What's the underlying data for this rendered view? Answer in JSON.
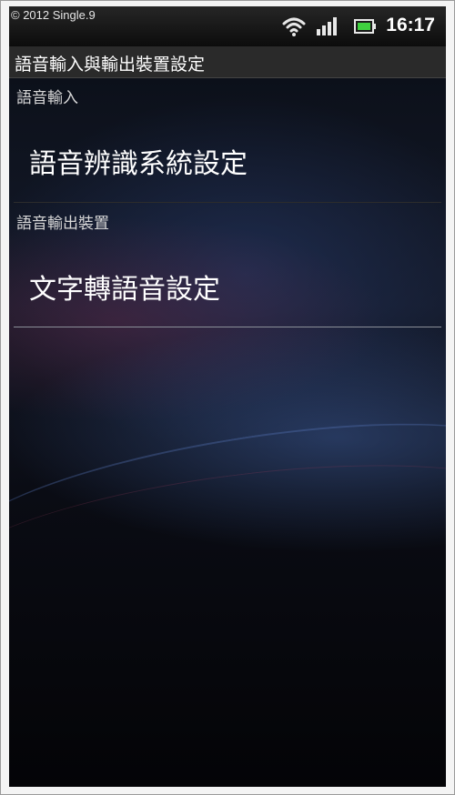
{
  "status_bar": {
    "copyright": "© 2012 Single.9",
    "time": "16:17",
    "icons": [
      "wifi-icon",
      "signal-icon",
      "battery-icon"
    ]
  },
  "title_bar": {
    "title": "語音輸入與輸出裝置設定"
  },
  "sections": [
    {
      "header": "語音輸入",
      "items": [
        {
          "label": "語音辨識系統設定"
        }
      ]
    },
    {
      "header": "語音輸出裝置",
      "items": [
        {
          "label": "文字轉語音設定"
        }
      ]
    }
  ],
  "colors": {
    "accent_battery": "#3fd13f",
    "background": "#000000",
    "text": "#ffffff"
  }
}
